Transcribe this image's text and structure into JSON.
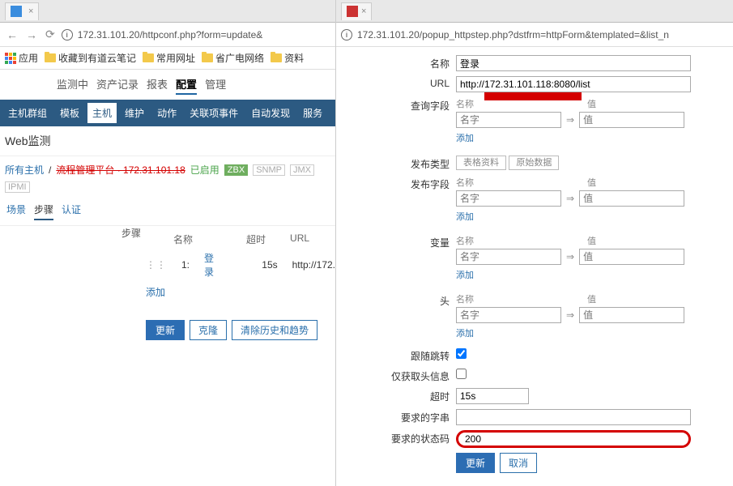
{
  "left": {
    "browser": {
      "tabTitle": "",
      "address": "172.31.101.20/httpconf.php?form=update&",
      "bookmarks": {
        "apps": "应用",
        "favs": "收藏到有道云笔记",
        "common": "常用网址",
        "net": "省广电网络",
        "res": "资料"
      }
    },
    "topnav": {
      "m1": "监测中",
      "m2": "资产记录",
      "m3": "报表",
      "m4": "配置",
      "m5": "管理"
    },
    "subnav": {
      "s1": "主机群组",
      "s2": "模板",
      "s3": "主机",
      "s4": "维护",
      "s5": "动作",
      "s6": "关联项事件",
      "s7": "自动发现",
      "s8": "服务"
    },
    "pageTitle": "Web监测",
    "crumb": {
      "all": "所有主机",
      "host": "流程管理平台 · 172.31.101.18",
      "enabled": "已启用",
      "zbx": "ZBX",
      "snmp": "SNMP",
      "jmx": "JMX",
      "ipmi": "IPMI"
    },
    "tabs": {
      "t1": "场景",
      "t2": "步骤",
      "t3": "认证"
    },
    "steps": {
      "label": "步骤",
      "hName": "名称",
      "hTimeout": "超时",
      "hUrl": "URL",
      "rowIdx": "1:",
      "rowName": "登录",
      "rowTimeout": "15s",
      "rowUrl": "http://172.",
      "add": "添加"
    },
    "buttons": {
      "update": "更新",
      "clone": "克隆",
      "clear": "清除历史和趋势"
    }
  },
  "right": {
    "address": "172.31.101.20/popup_httpstep.php?dstfrm=httpForm&templated=&list_n",
    "labels": {
      "name": "名称",
      "url": "URL",
      "query": "查询字段",
      "pubType": "发布类型",
      "pubFields": "发布字段",
      "vars": "变量",
      "headers": "头",
      "follow": "跟随跳转",
      "headOnly": "仅获取头信息",
      "timeout": "超时",
      "reqStr": "要求的字串",
      "reqStatus": "要求的状态码"
    },
    "values": {
      "name": "登录",
      "url": "http://172.31.101.118:8080/list",
      "timeout": "15s",
      "reqStr": "",
      "reqStatus": "200"
    },
    "pair": {
      "hName": "名称",
      "hVal": "值",
      "phName": "名字",
      "phVal": "值",
      "add": "添加"
    },
    "pubButtons": {
      "form": "表格资料",
      "raw": "原始数据"
    },
    "buttons": {
      "update": "更新",
      "cancel": "取消"
    }
  }
}
